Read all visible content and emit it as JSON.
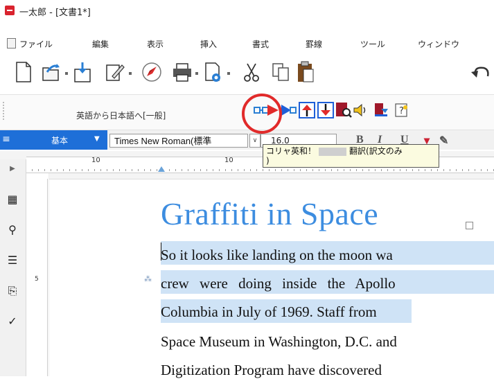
{
  "window": {
    "title": "一太郎 - [文書1*]"
  },
  "menu": [
    "ファイル",
    "編集",
    "表示",
    "挿入",
    "書式",
    "罫線",
    "ツール",
    "ウィンドウ"
  ],
  "translation_toolbar": {
    "direction_label": "英語から日本語へ[一般]"
  },
  "format_toolbar": {
    "menu_icon": "≡",
    "style": "基本",
    "font": "Times New Roman(標準",
    "font_size": "16.0",
    "bold": "B",
    "italic": "I",
    "underline": "U"
  },
  "tooltip": {
    "line1_left": "コリャ英和！",
    "line1_right": "翻訳(訳文のみ",
    "line2": ")"
  },
  "ruler": {
    "marks": [
      "10",
      "10"
    ]
  },
  "document": {
    "title": "Graffiti in Space",
    "lines": [
      "So it looks like landing on the moon wa",
      "crew were doing inside the Apollo",
      "Columbia in July of 1969. Staff from",
      "Space Museum in Washington, D.C. and",
      "Digitization Program have discovered"
    ]
  },
  "vertical_ruler": {
    "mark": "5"
  },
  "colors": {
    "accent": "#3d8de0",
    "highlight": "#cfe3f6",
    "circle": "#e12a2a",
    "style_bar": "#1e6fd8"
  }
}
